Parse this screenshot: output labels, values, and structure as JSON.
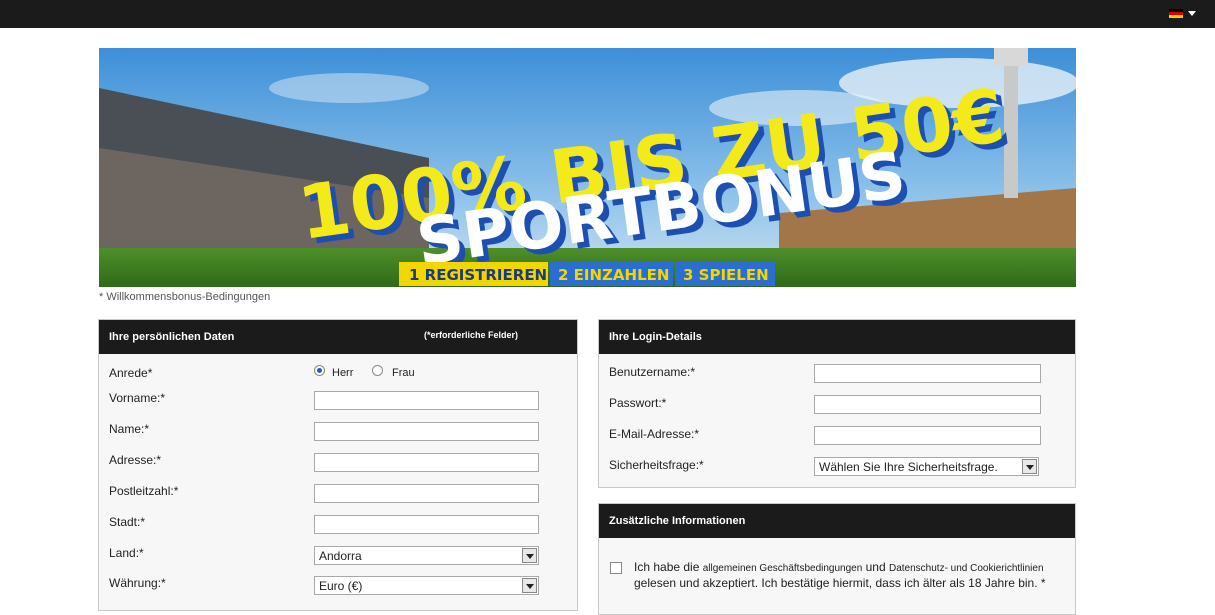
{
  "topbar": {
    "language_flag": "flag-de-icon"
  },
  "banner": {
    "headline": "100% BIS ZU 50€",
    "subline": "SPORTBONUS",
    "steps": [
      "1 REGISTRIEREN",
      "2 EINZAHLEN",
      "3 SPIELEN"
    ],
    "caption": "* Willkommensbonus-Bedingungen"
  },
  "personal": {
    "title": "Ihre persönlichen Daten",
    "note": "(*erforderliche Felder)",
    "salutation_label": "Anrede*",
    "salutation_options": [
      "Herr",
      "Frau"
    ],
    "salutation_selected": "Herr",
    "first_name_label": "Vorname:*",
    "last_name_label": "Name:*",
    "address_label": "Adresse:*",
    "postal_label": "Postleitzahl:*",
    "city_label": "Stadt:*",
    "country_label": "Land:*",
    "country_value": "Andorra",
    "currency_label": "Währung:*",
    "currency_value": "Euro (€)"
  },
  "login": {
    "title": "Ihre Login-Details",
    "username_label": "Benutzername:*",
    "password_label": "Passwort:*",
    "email_label": "E-Mail-Adresse:*",
    "security_label": "Sicherheitsfrage:*",
    "security_value": "Wählen Sie Ihre Sicherheitsfrage."
  },
  "additional": {
    "title": "Zusätzliche Informationen",
    "terms_p1": "Ich habe die ",
    "terms_link1": "allgemeinen Geschäftsbedingungen",
    "terms_p2": " und ",
    "terms_link2": "Datenschutz- und Cookierichtlinien",
    "terms_p3": " gelesen und akzeptiert. Ich bestätige hiermit, dass ich älter als 18 Jahre bin. *"
  },
  "colors": {
    "header_bg": "#1b1b1b",
    "headline_yellow": "#f4ea1a",
    "step_active": "#f2d600",
    "step_blue": "#2a6fcf"
  }
}
